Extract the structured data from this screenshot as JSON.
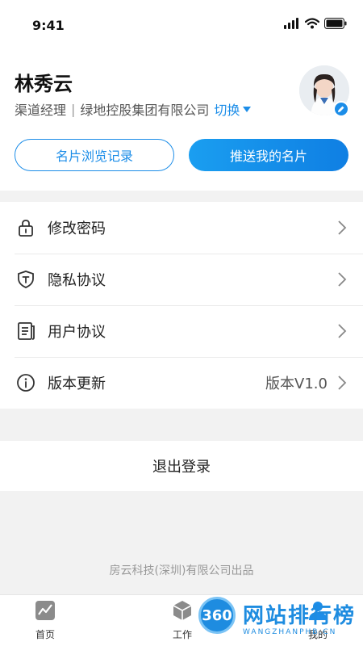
{
  "status_bar": {
    "time": "9:41",
    "icons": [
      "signal-icon",
      "wifi-icon",
      "battery-icon"
    ]
  },
  "profile": {
    "name": "林秀云",
    "role": "渠道经理",
    "separator": "|",
    "company": "绿地控股集团有限公司",
    "switch_label": "切换",
    "history_button": "名片浏览记录",
    "push_button": "推送我的名片"
  },
  "menu": {
    "items": [
      {
        "label": "修改密码",
        "icon": "lock-icon"
      },
      {
        "label": "隐私协议",
        "icon": "shield-icon"
      },
      {
        "label": "用户协议",
        "icon": "document-icon"
      },
      {
        "label": "版本更新",
        "icon": "info-icon",
        "value": "版本V1.0"
      }
    ]
  },
  "logout_label": "退出登录",
  "footer_note": "房云科技(深圳)有限公司出品",
  "tabbar": {
    "tabs": [
      {
        "label": "首页",
        "icon": "chart-icon"
      },
      {
        "label": "工作",
        "icon": "cube-icon"
      },
      {
        "label": "我的",
        "icon": "person-icon",
        "active": true
      }
    ]
  },
  "watermark": {
    "badge": "360",
    "title": "网站排行榜",
    "subtitle": "WANGZHANPHB.CN"
  },
  "colors": {
    "accent": "#1c8de8",
    "background": "#f2f2f2"
  }
}
